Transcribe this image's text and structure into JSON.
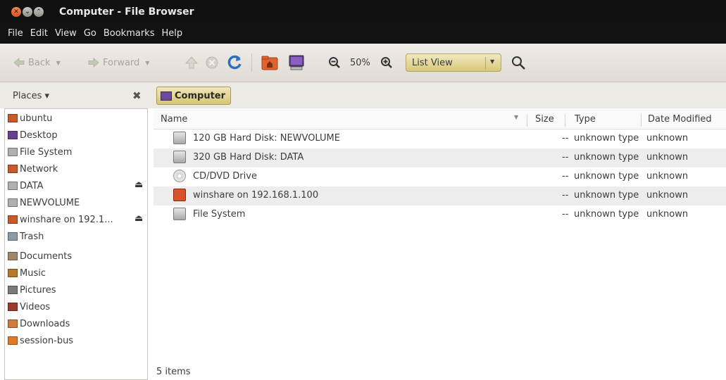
{
  "window": {
    "title": "Computer - File Browser",
    "controls": {
      "close": "✕",
      "minimize": "⌄",
      "maximize": "⌃"
    }
  },
  "menubar": [
    "File",
    "Edit",
    "View",
    "Go",
    "Bookmarks",
    "Help"
  ],
  "toolbar": {
    "back_label": "Back",
    "forward_label": "Forward",
    "zoom_level": "50%",
    "view_mode": "List View",
    "icons": [
      "back-arrow-icon",
      "forward-arrow-icon",
      "up-icon",
      "stop-icon",
      "reload-icon",
      "home-folder-icon",
      "computer-icon",
      "zoom-out-icon",
      "zoom-in-icon",
      "search-icon"
    ]
  },
  "location": {
    "places_label": "Places ▾",
    "close_glyph": "✖",
    "breadcrumb": "Computer"
  },
  "sidebar": {
    "items": [
      {
        "label": "ubuntu",
        "icon": "home-folder-icon",
        "color": "#c85a2a"
      },
      {
        "label": "Desktop",
        "icon": "desktop-icon",
        "color": "#6a3e8e"
      },
      {
        "label": "File System",
        "icon": "harddisk-icon",
        "color": "#9a9a9a"
      },
      {
        "label": "Network",
        "icon": "network-icon",
        "color": "#c85a2a"
      },
      {
        "label": "DATA",
        "icon": "harddisk-icon",
        "color": "#9a9a9a",
        "eject": true
      },
      {
        "label": "NEWVOLUME",
        "icon": "harddisk-icon",
        "color": "#9a9a9a"
      },
      {
        "label": "winshare on 192.1...",
        "icon": "network-share-icon",
        "color": "#c85a2a",
        "eject": true
      },
      {
        "label": "Trash",
        "icon": "trash-icon",
        "color": "#8a9aa8"
      },
      {
        "label": "Documents",
        "icon": "documents-folder-icon",
        "color": "#a0866a"
      },
      {
        "label": "Music",
        "icon": "music-folder-icon",
        "color": "#b8782a"
      },
      {
        "label": "Pictures",
        "icon": "pictures-folder-icon",
        "color": "#7a7a7a"
      },
      {
        "label": "Videos",
        "icon": "videos-folder-icon",
        "color": "#9a3a2a"
      },
      {
        "label": "Downloads",
        "icon": "downloads-folder-icon",
        "color": "#d07a3a"
      },
      {
        "label": "session-bus",
        "icon": "folder-icon",
        "color": "#e07a2a"
      }
    ],
    "eject_glyph": "⏏"
  },
  "list": {
    "columns": [
      "Name",
      "Size",
      "Type",
      "Date Modified"
    ],
    "sort_glyph": "▼",
    "rows": [
      {
        "name": "120 GB Hard Disk: NEWVOLUME",
        "size": "--",
        "type": "unknown type",
        "date": "unknown",
        "icon": "harddisk-icon"
      },
      {
        "name": "320 GB Hard Disk: DATA",
        "size": "--",
        "type": "unknown type",
        "date": "unknown",
        "icon": "harddisk-icon"
      },
      {
        "name": "CD/DVD Drive",
        "size": "--",
        "type": "unknown type",
        "date": "unknown",
        "icon": "cdrom-icon"
      },
      {
        "name": "winshare on 192.168.1.100",
        "size": "--",
        "type": "unknown type",
        "date": "unknown",
        "icon": "network-share-icon"
      },
      {
        "name": "File System",
        "size": "--",
        "type": "unknown type",
        "date": "unknown",
        "icon": "harddisk-icon"
      }
    ]
  },
  "status": {
    "text": "5 items"
  },
  "colors": {
    "accent": "#dcc978",
    "titlebar": "#111111"
  }
}
